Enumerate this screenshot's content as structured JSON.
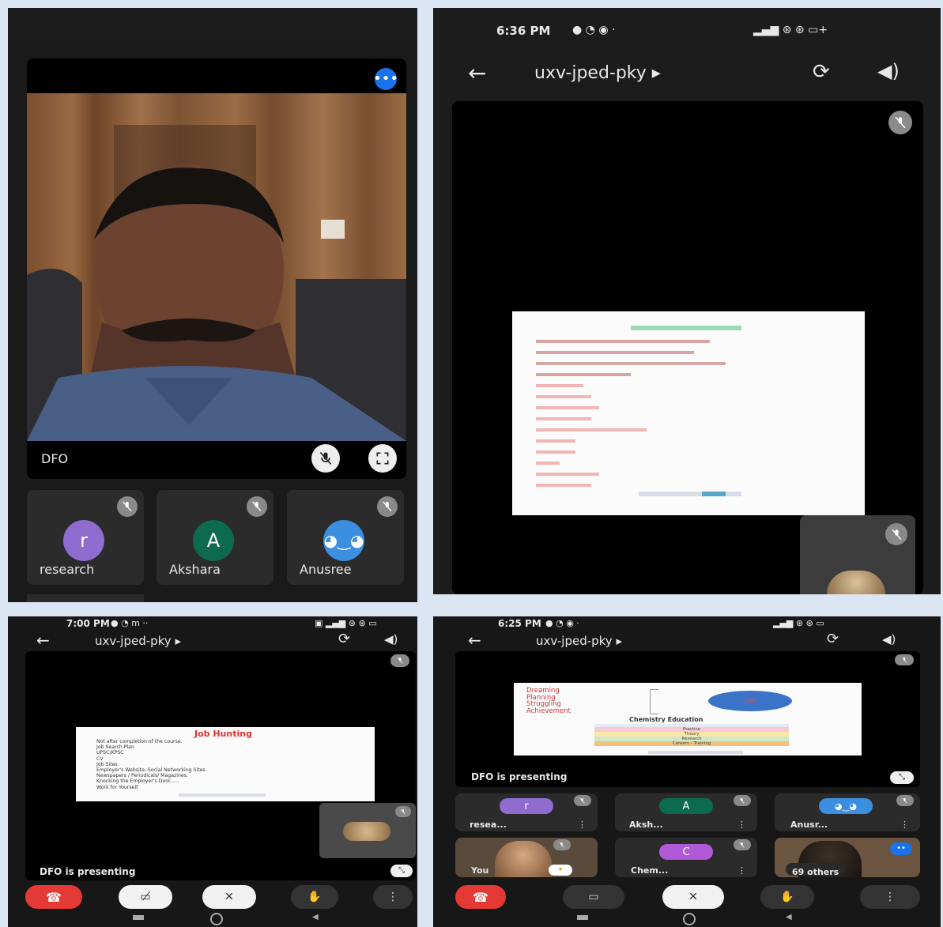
{
  "p1": {
    "speaker_name": "DFO",
    "participants": [
      {
        "initial": "r",
        "name": "research",
        "color": "#8e6cd0"
      },
      {
        "initial": "A",
        "name": "Akshara",
        "color": "#0c6b4e"
      },
      {
        "initial": "",
        "name": "Anusree",
        "color": "#3c8ee0"
      }
    ]
  },
  "p2": {
    "time": "6:36 PM",
    "meeting_code": "uxv-jped-pky ▸"
  },
  "p3": {
    "time": "7:00 PM",
    "meeting_code": "uxv-jped-pky ▸",
    "slide_title": "Job Hunting",
    "slide_items": [
      "Not after completion of the course.",
      "Job Search Plan",
      "UPSC/KPSC",
      "CV",
      "Job Sites.",
      "Employer's Website, Social Networking Sites.",
      "Newspapers / Periodicals/ Magazines.",
      "Knocking the Employer's Door......",
      "Work for Yourself."
    ],
    "presenting_label": "DFO is presenting"
  },
  "p4": {
    "time": "6:25 PM",
    "meeting_code": "uxv-jped-pky ▸",
    "slide_items": [
      "Dreaming",
      "Planning",
      "Struggling",
      "Achievement"
    ],
    "slide_oval_label": "LIFE",
    "slide_subtitle": "Chemistry Education",
    "slide_table_rows": [
      "Practice",
      "Theory",
      "Research",
      "Careers - Training"
    ],
    "presenting_label": "DFO is presenting",
    "participants": [
      {
        "initial": "r",
        "name": "resea...",
        "color": "#8e6cd0"
      },
      {
        "initial": "A",
        "name": "Aksh...",
        "color": "#0c6b4e"
      },
      {
        "initial": "",
        "name": "Anusr...",
        "color": "#3c8ee0"
      },
      {
        "initial": "",
        "name": "You",
        "color": "#c9a37a"
      },
      {
        "initial": "C",
        "name": "Chem...",
        "color": "#b15ad8"
      },
      {
        "initial": "",
        "name": "69 others",
        "color": "#6b5440"
      }
    ]
  },
  "colors": {
    "end_call": "#e53935",
    "panel_bg": "#121212",
    "tile_bg": "#2b2b2b",
    "accent_blue": "#1a73e8"
  }
}
